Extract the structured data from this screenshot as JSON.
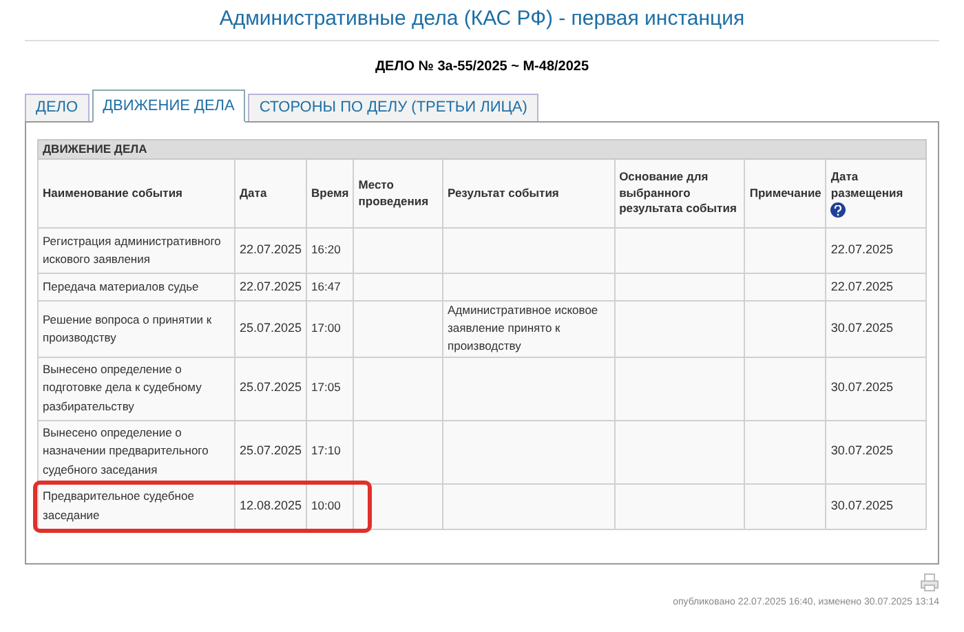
{
  "page_title": "Административные дела (КАС РФ) - первая инстанция",
  "case_number": "ДЕЛО № 3а-55/2025 ~ М-48/2025",
  "tabs": [
    {
      "label": "ДЕЛО",
      "selected": false
    },
    {
      "label": "ДВИЖЕНИЕ ДЕЛА",
      "selected": true
    },
    {
      "label": "СТОРОНЫ ПО ДЕЛУ (ТРЕТЬИ ЛИЦА)",
      "selected": false
    }
  ],
  "table": {
    "title": "ДВИЖЕНИЕ ДЕЛА",
    "columns": [
      "Наименование события",
      "Дата",
      "Время",
      "Место проведения",
      "Результат события",
      "Основание для выбранного результата события",
      "Примечание",
      "Дата размещения"
    ],
    "rows": [
      {
        "cells": [
          "Регистрация административного искового заявления",
          "22.07.2025",
          "16:20",
          "",
          "",
          "",
          "",
          "22.07.2025"
        ],
        "highlighted": false
      },
      {
        "cells": [
          "Передача материалов судье",
          "22.07.2025",
          "16:47",
          "",
          "",
          "",
          "",
          "22.07.2025"
        ],
        "highlighted": false
      },
      {
        "cells": [
          "Решение вопроса о принятии к производству",
          "25.07.2025",
          "17:00",
          "",
          "Административное исковое заявление принято к производству",
          "",
          "",
          "30.07.2025"
        ],
        "highlighted": false
      },
      {
        "cells": [
          "Вынесено определение о подготовке дела к судебному разбирательству",
          "25.07.2025",
          "17:05",
          "",
          "",
          "",
          "",
          "30.07.2025"
        ],
        "highlighted": false
      },
      {
        "cells": [
          "Вынесено определение о назначении предварительного судебного заседания",
          "25.07.2025",
          "17:10",
          "",
          "",
          "",
          "",
          "30.07.2025"
        ],
        "highlighted": false
      },
      {
        "cells": [
          "Предварительное судебное заседание",
          "12.08.2025",
          "10:00",
          "",
          "",
          "",
          "",
          "30.07.2025"
        ],
        "highlighted": true
      }
    ]
  },
  "footer": "опубликовано 22.07.2025 16:40, изменено 30.07.2025 13:14"
}
